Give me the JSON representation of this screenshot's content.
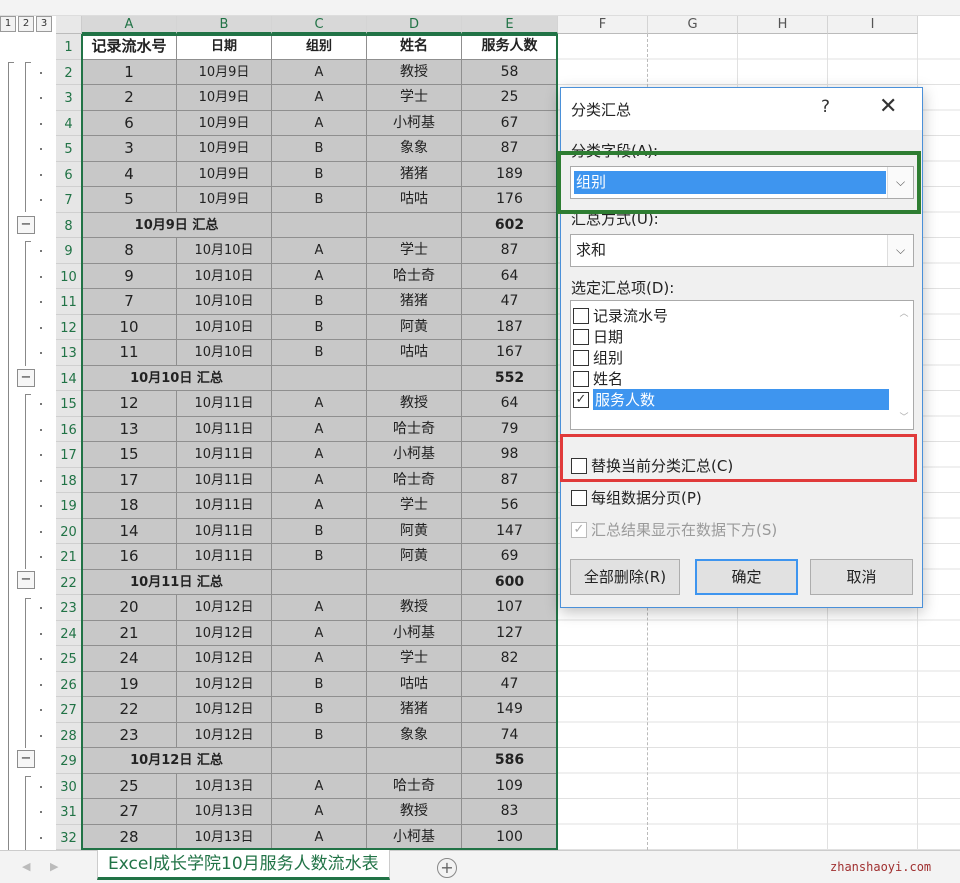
{
  "outline_levels": [
    "1",
    "2",
    "3"
  ],
  "columns": [
    "A",
    "B",
    "C",
    "D",
    "E",
    "F",
    "G",
    "H",
    "I"
  ],
  "row_numbers": [
    "1",
    "2",
    "3",
    "4",
    "5",
    "6",
    "7",
    "8",
    "9",
    "10",
    "11",
    "12",
    "13",
    "14",
    "15",
    "16",
    "17",
    "18",
    "19",
    "20",
    "21",
    "22",
    "23",
    "24",
    "25",
    "26",
    "27",
    "28",
    "29",
    "30",
    "31",
    "32"
  ],
  "table": {
    "headers": [
      "记录流水号",
      "日期",
      "组别",
      "姓名",
      "服务人数"
    ],
    "rows": [
      {
        "type": "data",
        "a": "1",
        "b": "10月9日",
        "c": "A",
        "d": "教授",
        "e": "58"
      },
      {
        "type": "data",
        "a": "2",
        "b": "10月9日",
        "c": "A",
        "d": "学士",
        "e": "25"
      },
      {
        "type": "data",
        "a": "6",
        "b": "10月9日",
        "c": "A",
        "d": "小柯基",
        "e": "67"
      },
      {
        "type": "data",
        "a": "3",
        "b": "10月9日",
        "c": "B",
        "d": "象象",
        "e": "87"
      },
      {
        "type": "data",
        "a": "4",
        "b": "10月9日",
        "c": "B",
        "d": "猪猪",
        "e": "189"
      },
      {
        "type": "data",
        "a": "5",
        "b": "10月9日",
        "c": "B",
        "d": "咕咕",
        "e": "176"
      },
      {
        "type": "sum",
        "a": "",
        "b": "10月9日 汇总",
        "c": "",
        "d": "",
        "e": "602"
      },
      {
        "type": "data",
        "a": "8",
        "b": "10月10日",
        "c": "A",
        "d": "学士",
        "e": "87"
      },
      {
        "type": "data",
        "a": "9",
        "b": "10月10日",
        "c": "A",
        "d": "哈士奇",
        "e": "64"
      },
      {
        "type": "data",
        "a": "7",
        "b": "10月10日",
        "c": "B",
        "d": "猪猪",
        "e": "47"
      },
      {
        "type": "data",
        "a": "10",
        "b": "10月10日",
        "c": "B",
        "d": "阿黄",
        "e": "187"
      },
      {
        "type": "data",
        "a": "11",
        "b": "10月10日",
        "c": "B",
        "d": "咕咕",
        "e": "167"
      },
      {
        "type": "sum",
        "a": "",
        "b": "10月10日 汇总",
        "c": "",
        "d": "",
        "e": "552"
      },
      {
        "type": "data",
        "a": "12",
        "b": "10月11日",
        "c": "A",
        "d": "教授",
        "e": "64"
      },
      {
        "type": "data",
        "a": "13",
        "b": "10月11日",
        "c": "A",
        "d": "哈士奇",
        "e": "79"
      },
      {
        "type": "data",
        "a": "15",
        "b": "10月11日",
        "c": "A",
        "d": "小柯基",
        "e": "98"
      },
      {
        "type": "data",
        "a": "17",
        "b": "10月11日",
        "c": "A",
        "d": "哈士奇",
        "e": "87"
      },
      {
        "type": "data",
        "a": "18",
        "b": "10月11日",
        "c": "A",
        "d": "学士",
        "e": "56"
      },
      {
        "type": "data",
        "a": "14",
        "b": "10月11日",
        "c": "B",
        "d": "阿黄",
        "e": "147"
      },
      {
        "type": "data",
        "a": "16",
        "b": "10月11日",
        "c": "B",
        "d": "阿黄",
        "e": "69"
      },
      {
        "type": "sum",
        "a": "",
        "b": "10月11日 汇总",
        "c": "",
        "d": "",
        "e": "600"
      },
      {
        "type": "data",
        "a": "20",
        "b": "10月12日",
        "c": "A",
        "d": "教授",
        "e": "107"
      },
      {
        "type": "data",
        "a": "21",
        "b": "10月12日",
        "c": "A",
        "d": "小柯基",
        "e": "127"
      },
      {
        "type": "data",
        "a": "24",
        "b": "10月12日",
        "c": "A",
        "d": "学士",
        "e": "82"
      },
      {
        "type": "data",
        "a": "19",
        "b": "10月12日",
        "c": "B",
        "d": "咕咕",
        "e": "47"
      },
      {
        "type": "data",
        "a": "22",
        "b": "10月12日",
        "c": "B",
        "d": "猪猪",
        "e": "149"
      },
      {
        "type": "data",
        "a": "23",
        "b": "10月12日",
        "c": "B",
        "d": "象象",
        "e": "74"
      },
      {
        "type": "sum",
        "a": "",
        "b": "10月12日 汇总",
        "c": "",
        "d": "",
        "e": "586"
      },
      {
        "type": "data",
        "a": "25",
        "b": "10月13日",
        "c": "A",
        "d": "哈士奇",
        "e": "109"
      },
      {
        "type": "data",
        "a": "27",
        "b": "10月13日",
        "c": "A",
        "d": "教授",
        "e": "83"
      },
      {
        "type": "data",
        "a": "28",
        "b": "10月13日",
        "c": "A",
        "d": "小柯基",
        "e": "100"
      }
    ]
  },
  "dialog": {
    "title": "分类汇总",
    "help": "?",
    "close": "✕",
    "group_field_label": "分类字段(A):",
    "group_field_value": "组别",
    "summary_method_label": "汇总方式(U):",
    "summary_method_value": "求和",
    "summary_items_label": "选定汇总项(D):",
    "summary_items": [
      {
        "label": "记录流水号",
        "checked": false
      },
      {
        "label": "日期",
        "checked": false
      },
      {
        "label": "组别",
        "checked": false
      },
      {
        "label": "姓名",
        "checked": false
      },
      {
        "label": "服务人数",
        "checked": true
      }
    ],
    "replace_current": "替换当前分类汇总(C)",
    "page_break": "每组数据分页(P)",
    "summary_below": "汇总结果显示在数据下方(S)",
    "remove_all": "全部删除(R)",
    "ok": "确定",
    "cancel": "取消"
  },
  "sheet_tab": "Excel成长学院10月服务人数流水表",
  "add_sheet": "+",
  "watermark": "zhanshaoyi.com",
  "colors": {
    "excel_green": "#217346",
    "highlight_green": "#2e7d32",
    "highlight_red": "#e03a3a",
    "selection_blue": "#3e95ef"
  }
}
